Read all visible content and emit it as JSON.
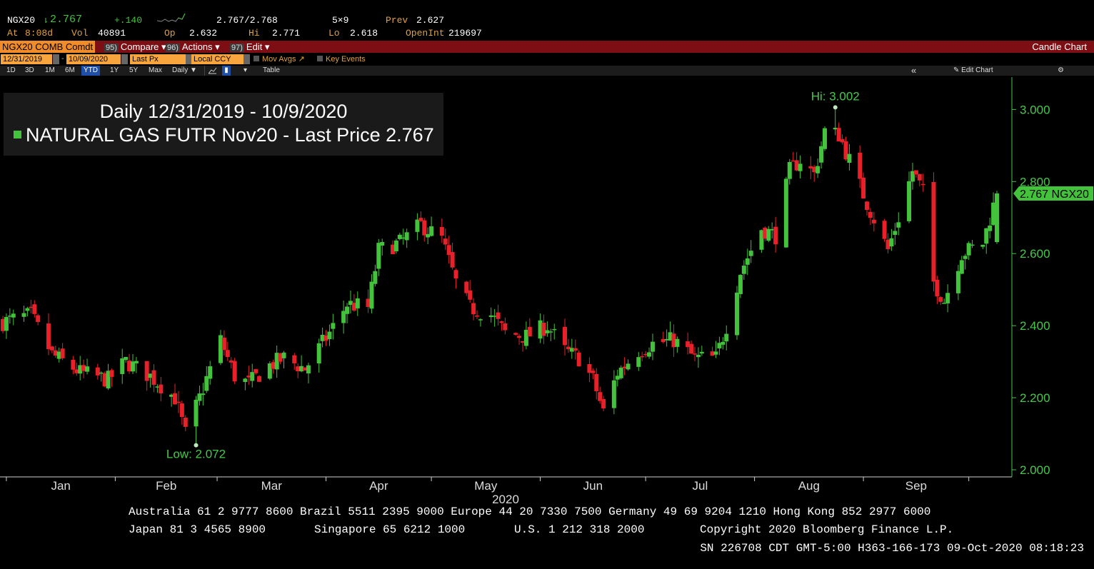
{
  "quote": {
    "ticker": "NGX20",
    "last_arrow": "⇂",
    "last": "2.767",
    "change": "+.140",
    "bid_ask": "2.767/2.768",
    "size": "5×9",
    "prev_label": "Prev",
    "prev": "2.627",
    "at_label": "At",
    "at_value": "8:08d",
    "vol_label": "Vol",
    "vol": "40891",
    "op_label": "Op",
    "op": "2.632",
    "hi_label": "Hi",
    "hi": "2.771",
    "lo_label": "Lo",
    "lo": "2.618",
    "oi_label": "OpenInt",
    "oi": "219697"
  },
  "command_bar": {
    "security": "NGX20 COMB Comdt",
    "compare_num": "95)",
    "compare": "Compare ▾",
    "actions_num": "96)",
    "actions": "Actions ▾",
    "edit_num": "97)",
    "edit": "Edit ▾",
    "chart_type": "Candle Chart"
  },
  "options": {
    "start_date": "12/31/2019",
    "end_date": "10/09/2020",
    "field": "Last Px",
    "currency": "Local CCY",
    "mov_avgs": "Mov Avgs ↗",
    "key_events": "Key Events"
  },
  "periods": {
    "items": [
      "1D",
      "3D",
      "1M",
      "6M",
      "YTD",
      "1Y",
      "5Y",
      "Max"
    ],
    "selected": "YTD",
    "frequency": "Daily ▼",
    "table": "Table",
    "collapse": "«",
    "edit_chart": "Edit Chart",
    "settings_icon": "gear-icon"
  },
  "legend": {
    "line1": "Daily 12/31/2019 - 10/9/2020",
    "series_name": "NATURAL GAS FUTR  Nov20 - Last Price",
    "series_value": "2.767"
  },
  "colors": {
    "up": "#43c23c",
    "down": "#e8202a",
    "axis_text": "#45c94a",
    "header_bar": "#7d0f14",
    "accent": "#f28c28"
  },
  "chart_data": {
    "type": "candlestick",
    "title": "Daily 12/31/2019 - 10/9/2020",
    "series_name": "NATURAL GAS FUTR  Nov20 - Last Price",
    "last_price": 2.767,
    "last_label": "2.767 NGX20",
    "ylim": [
      2.0,
      3.08
    ],
    "y_ticks": [
      "3.000",
      "2.800",
      "2.600",
      "2.400",
      "2.200",
      "2.000"
    ],
    "x_month_labels": [
      "Jan",
      "Feb",
      "Mar",
      "Apr",
      "May",
      "Jun",
      "Jul",
      "Aug",
      "Sep"
    ],
    "x_year_label": "2020",
    "x_range": [
      "2019-12-31",
      "2020-10-09"
    ],
    "hi_annotation": {
      "text": "Hi: 3.002",
      "date": "2020-08-24",
      "value": 3.002
    },
    "low_annotation": {
      "text": "Low: 2.072",
      "date": "2020-02-24",
      "value": 2.072
    },
    "anchors": [
      [
        "2019-12-31",
        2.41
      ],
      [
        "2020-01-08",
        2.43
      ],
      [
        "2020-01-14",
        2.32
      ],
      [
        "2020-01-22",
        2.27
      ],
      [
        "2020-01-30",
        2.25
      ],
      [
        "2020-02-04",
        2.3
      ],
      [
        "2020-02-11",
        2.26
      ],
      [
        "2020-02-18",
        2.2
      ],
      [
        "2020-02-21",
        2.1
      ],
      [
        "2020-02-25",
        2.2
      ],
      [
        "2020-03-02",
        2.36
      ],
      [
        "2020-03-06",
        2.26
      ],
      [
        "2020-03-10",
        2.24
      ],
      [
        "2020-03-16",
        2.29
      ],
      [
        "2020-03-20",
        2.31
      ],
      [
        "2020-03-26",
        2.28
      ],
      [
        "2020-04-02",
        2.38
      ],
      [
        "2020-04-07",
        2.46
      ],
      [
        "2020-04-13",
        2.45
      ],
      [
        "2020-04-16",
        2.61
      ],
      [
        "2020-04-22",
        2.63
      ],
      [
        "2020-04-28",
        2.68
      ],
      [
        "2020-05-04",
        2.64
      ],
      [
        "2020-05-08",
        2.52
      ],
      [
        "2020-05-12",
        2.45
      ],
      [
        "2020-05-18",
        2.43
      ],
      [
        "2020-05-22",
        2.38
      ],
      [
        "2020-05-28",
        2.37
      ],
      [
        "2020-06-03",
        2.4
      ],
      [
        "2020-06-08",
        2.33
      ],
      [
        "2020-06-12",
        2.31
      ],
      [
        "2020-06-16",
        2.25
      ],
      [
        "2020-06-19",
        2.16
      ],
      [
        "2020-06-23",
        2.27
      ],
      [
        "2020-06-29",
        2.33
      ],
      [
        "2020-07-03",
        2.35
      ],
      [
        "2020-07-09",
        2.36
      ],
      [
        "2020-07-15",
        2.31
      ],
      [
        "2020-07-21",
        2.31
      ],
      [
        "2020-07-24",
        2.4
      ],
      [
        "2020-07-28",
        2.55
      ],
      [
        "2020-08-03",
        2.67
      ],
      [
        "2020-08-07",
        2.65
      ],
      [
        "2020-08-11",
        2.83
      ],
      [
        "2020-08-14",
        2.86
      ],
      [
        "2020-08-18",
        2.82
      ],
      [
        "2020-08-21",
        2.94
      ],
      [
        "2020-08-25",
        2.93
      ],
      [
        "2020-08-28",
        2.86
      ],
      [
        "2020-09-02",
        2.74
      ],
      [
        "2020-09-08",
        2.61
      ],
      [
        "2020-09-11",
        2.7
      ],
      [
        "2020-09-15",
        2.83
      ],
      [
        "2020-09-18",
        2.77
      ],
      [
        "2020-09-21",
        2.52
      ],
      [
        "2020-09-24",
        2.47
      ],
      [
        "2020-09-29",
        2.6
      ],
      [
        "2020-10-05",
        2.63
      ],
      [
        "2020-10-09",
        2.767
      ]
    ]
  },
  "footer": {
    "line1": "Australia 61 2 9777 8600 Brazil 5511 2395 9000 Europe 44 20 7330 7500 Germany 49 69 9204 1210 Hong Kong 852 2977 6000",
    "line2_a": "Japan 81 3 4565 8900",
    "line2_b": "Singapore 65 6212 1000",
    "line2_c": "U.S. 1 212 318 2000",
    "line2_d": "Copyright 2020 Bloomberg Finance L.P.",
    "line3": "SN 226708 CDT  GMT-5:00 H363-166-173 09-Oct-2020 08:18:23"
  }
}
